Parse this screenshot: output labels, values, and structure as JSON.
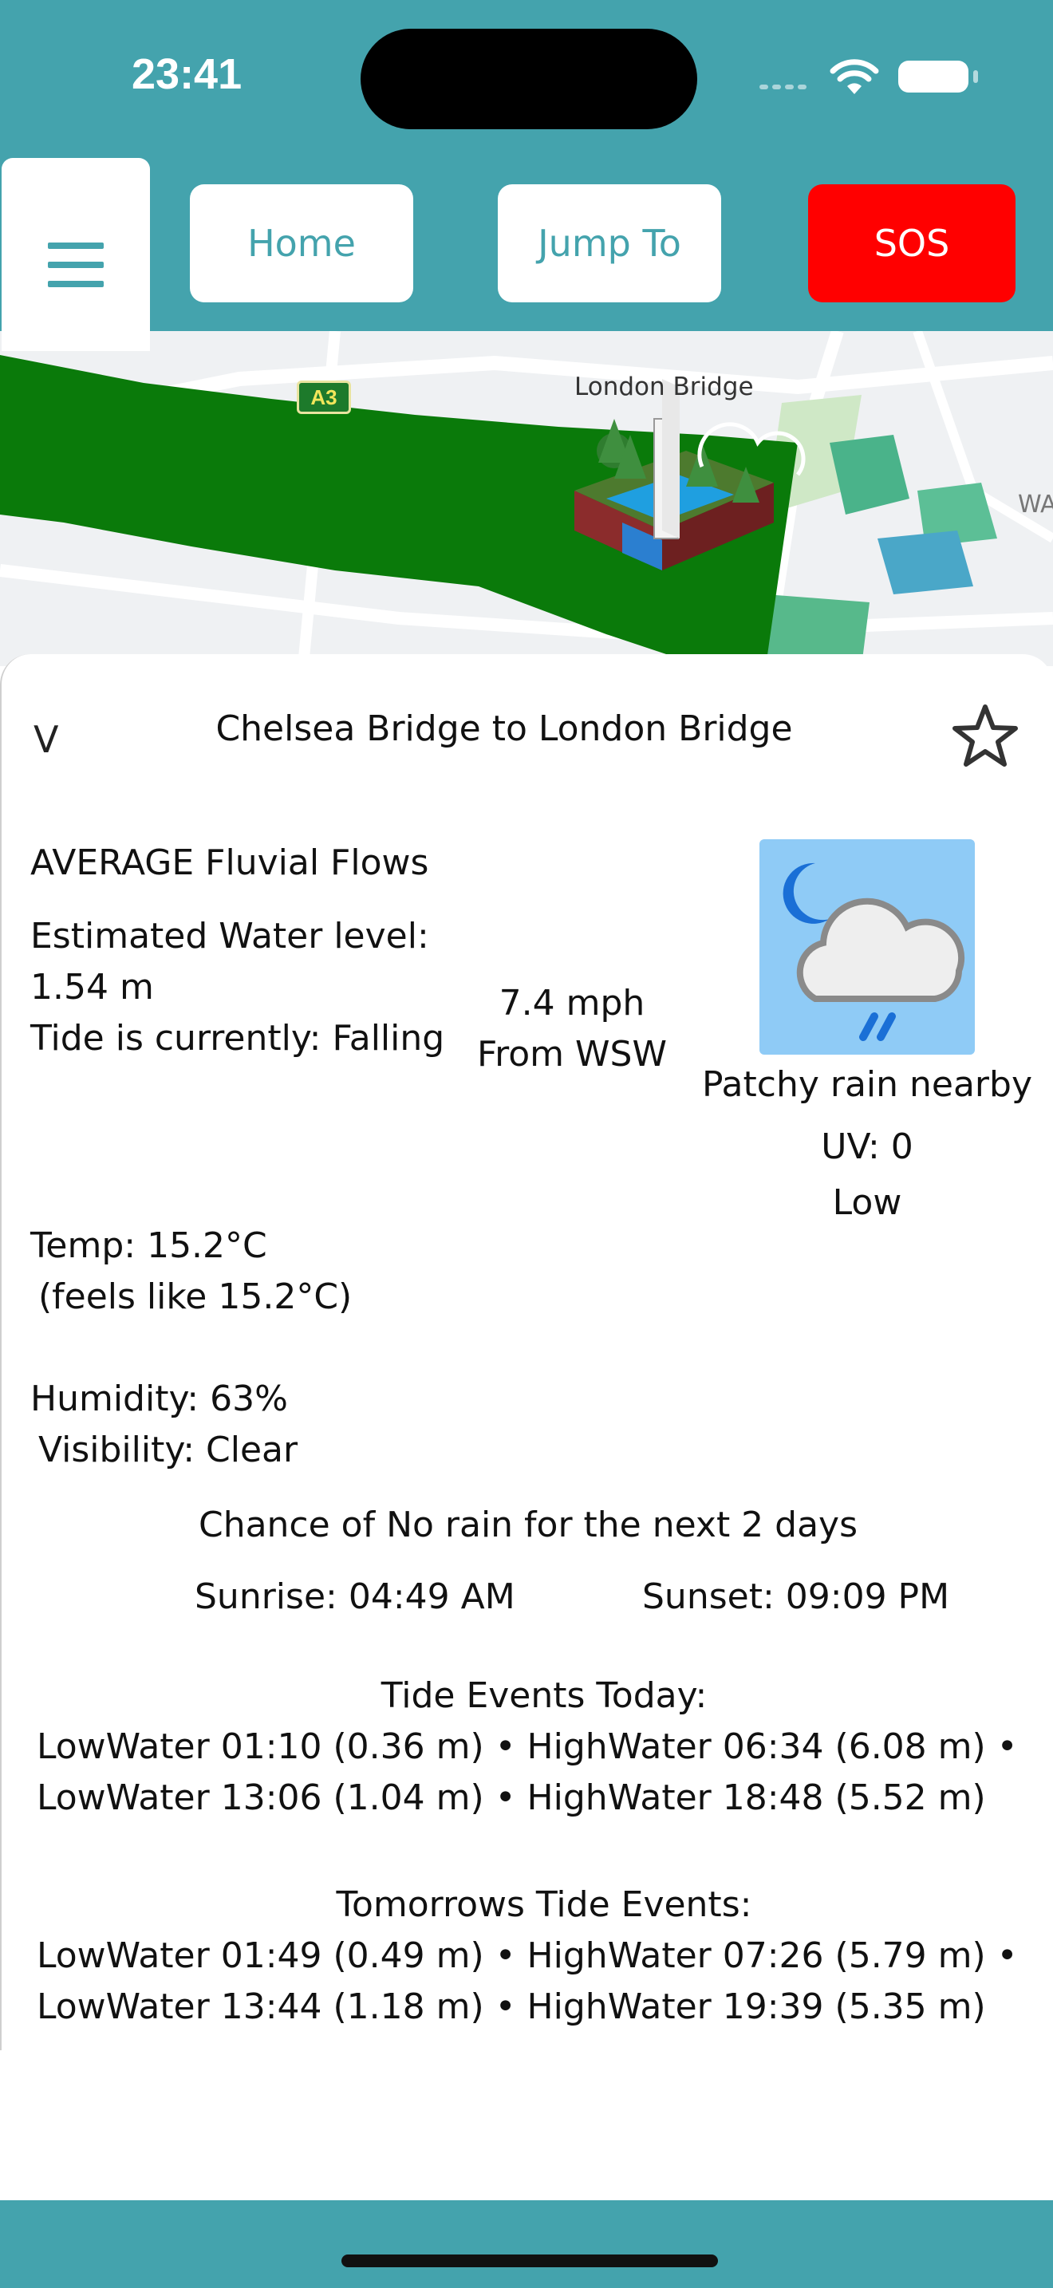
{
  "status_bar": {
    "time": "23:41"
  },
  "header": {
    "menu_icon": "hamburger-icon",
    "home_label": "Home",
    "jump_label": "Jump To",
    "sos_label": "SOS"
  },
  "map": {
    "place_label": "London Bridge",
    "road_badge": "A3",
    "edge_text": "WA",
    "highlight_color": "#0a7a0a"
  },
  "panel": {
    "collapse_label": "V",
    "title": "Chelsea Bridge to London Bridge",
    "favorite_icon": "star-icon",
    "flow": "AVERAGE Fluvial Flows",
    "water_level_label": "Estimated Water level:",
    "water_level_value": "1.54 m",
    "tide_state": "Tide is currently: Falling",
    "wind_speed": "7.4 mph",
    "wind_direction": "From WSW",
    "weather_icon": "partly-cloudy-night-rain-icon",
    "condition": "Patchy rain nearby",
    "uv": "UV: 0",
    "uv_level": "Low",
    "temp": "Temp: 15.2°C",
    "feels_like": "(feels like 15.2°C)",
    "humidity": "Humidity: 63%",
    "visibility": "Visibility: Clear",
    "rain_chance": "Chance of No rain for the next 2 days",
    "sunrise": "Sunrise: 04:49 AM",
    "sunset": "Sunset: 09:09 PM",
    "tide_today_title": "Tide Events Today:",
    "tide_today_line1": "LowWater 01:10 (0.36 m) • HighWater 06:34 (6.08 m) •",
    "tide_today_line2": "LowWater 13:06 (1.04 m) • HighWater 18:48 (5.52 m)",
    "tide_tomorrow_title": "Tomorrows Tide Events:",
    "tide_tomorrow_line1": "LowWater 01:49 (0.49 m) • HighWater 07:26 (5.79 m) •",
    "tide_tomorrow_line2": "LowWater 13:44 (1.18 m) • HighWater 19:39 (5.35 m)"
  },
  "colors": {
    "brand": "#44a3ad",
    "sos": "#ff0000",
    "weather_tile": "#8fcbf6"
  }
}
